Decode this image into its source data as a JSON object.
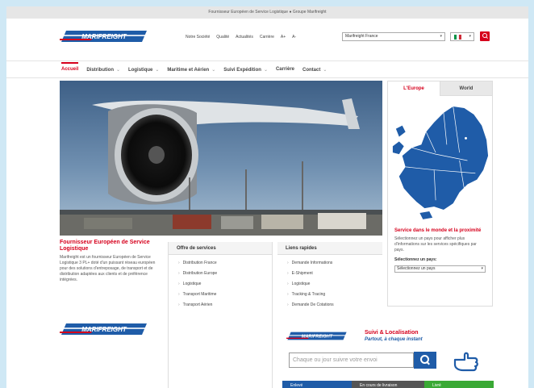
{
  "topbar": {
    "text": "Fournisseur Européen de Service Logistique ● Groupe Marifreight"
  },
  "header": {
    "logo_alt": "MARIFREIGHT",
    "links": [
      "Notre Société",
      "Qualité",
      "Actualités",
      "Carrière",
      "A+",
      "A-"
    ],
    "site_select": "Marifreight France",
    "lang_flag_colors": [
      "#009246",
      "#ffffff",
      "#ce2b37"
    ]
  },
  "nav": {
    "items": [
      {
        "label": "Accueil",
        "has_submenu": false,
        "active": true
      },
      {
        "label": "Distribution",
        "has_submenu": true,
        "active": false
      },
      {
        "label": "Logistique",
        "has_submenu": true,
        "active": false
      },
      {
        "label": "Maritime et Aérien",
        "has_submenu": true,
        "active": false
      },
      {
        "label": "Suivi Expédition",
        "has_submenu": true,
        "active": false
      },
      {
        "label": "Carrière",
        "has_submenu": false,
        "active": false
      },
      {
        "label": "Contact",
        "has_submenu": true,
        "active": false
      }
    ]
  },
  "map_panel": {
    "tabs": [
      "L'Europe",
      "World"
    ],
    "title": "Service dans le monde et la proximité",
    "description": "Sélectionnez un pays pour afficher plus d'informations sur les services spécifiques par pays.",
    "select_label": "Sélectionnez un pays:",
    "select_value": "Sélectionnez un pays"
  },
  "intro": {
    "heading": "Fournisseur Européen de Service Logistique",
    "text": "Marifreight est un fournisseur Européen de Service Logistique 3 PL+ doté d'un puissant réseau européen pour des solutions d'entreposage, de transport et de distribution adaptées aux clients et de préférence intégrées."
  },
  "services": {
    "heading": "Offre de services",
    "items": [
      "Distribution France",
      "Distribution Europe",
      "Logistique",
      "Transport Maritime",
      "Transport Aérien"
    ]
  },
  "quick_links": {
    "heading": "Liens rapides",
    "items": [
      "Demande Informations",
      "E-Shipment",
      "Logistique",
      "Tracking & Tracing",
      "Demande De Cotations"
    ]
  },
  "tracking": {
    "title": "Suivi & Localisation",
    "subtitle": "Partout, à chaque instant",
    "placeholder": "Chaque ou jour suivre votre envoi",
    "status": [
      "Enlevé",
      "En cours de livraison",
      "Livré"
    ]
  },
  "colors": {
    "accent": "#d6001c",
    "brand_blue": "#1f5ca8",
    "green": "#3aa935"
  }
}
